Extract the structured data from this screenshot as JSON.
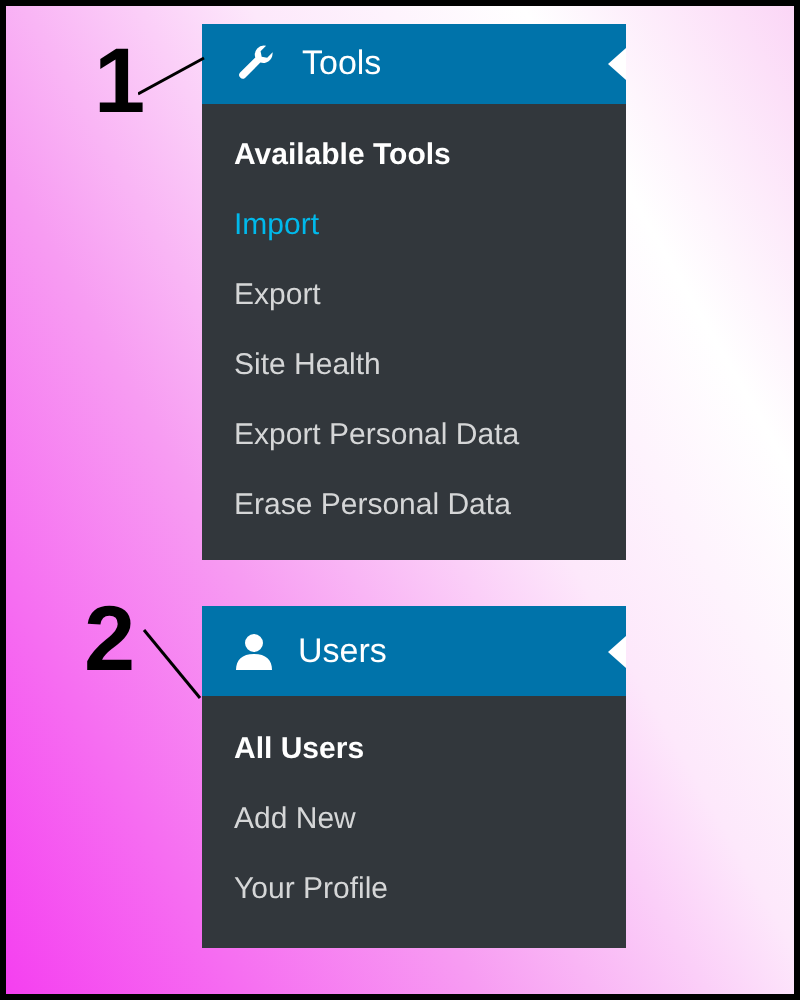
{
  "menus": [
    {
      "callout": "1",
      "kind": "tools",
      "title": "Tools",
      "items": [
        {
          "label": "Available Tools",
          "selected": true,
          "hovered": false
        },
        {
          "label": "Import",
          "selected": false,
          "hovered": true
        },
        {
          "label": "Export",
          "selected": false,
          "hovered": false
        },
        {
          "label": "Site Health",
          "selected": false,
          "hovered": false
        },
        {
          "label": "Export Personal Data",
          "selected": false,
          "hovered": false
        },
        {
          "label": "Erase Personal Data",
          "selected": false,
          "hovered": false
        }
      ]
    },
    {
      "callout": "2",
      "kind": "users",
      "title": "Users",
      "items": [
        {
          "label": "All Users",
          "selected": true,
          "hovered": false
        },
        {
          "label": "Add New",
          "selected": false,
          "hovered": false
        },
        {
          "label": "Your Profile",
          "selected": false,
          "hovered": false
        }
      ]
    }
  ]
}
